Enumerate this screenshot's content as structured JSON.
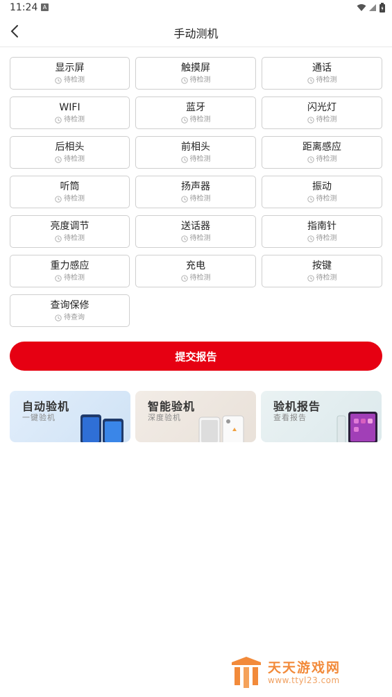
{
  "status_bar": {
    "time": "11:24",
    "notif_letter": "A"
  },
  "header": {
    "title": "手动测机"
  },
  "tests": [
    {
      "name": "显示屏",
      "status": "待检测"
    },
    {
      "name": "触摸屏",
      "status": "待检测"
    },
    {
      "name": "通话",
      "status": "待检测"
    },
    {
      "name": "WIFI",
      "status": "待检测"
    },
    {
      "name": "蓝牙",
      "status": "待检测"
    },
    {
      "name": "闪光灯",
      "status": "待检测"
    },
    {
      "name": "后相头",
      "status": "待检测"
    },
    {
      "name": "前相头",
      "status": "待检测"
    },
    {
      "name": "距离感应",
      "status": "待检测"
    },
    {
      "name": "听筒",
      "status": "待检测"
    },
    {
      "name": "扬声器",
      "status": "待检测"
    },
    {
      "name": "振动",
      "status": "待检测"
    },
    {
      "name": "亮度调节",
      "status": "待检测"
    },
    {
      "name": "送话器",
      "status": "待检测"
    },
    {
      "name": "指南针",
      "status": "待检测"
    },
    {
      "name": "重力感应",
      "status": "待检测"
    },
    {
      "name": "充电",
      "status": "待检测"
    },
    {
      "name": "按键",
      "status": "待检测"
    },
    {
      "name": "查询保修",
      "status": "待查询"
    }
  ],
  "submit_label": "提交报告",
  "banners": [
    {
      "title": "自动验机",
      "subtitle": "一键验机"
    },
    {
      "title": "智能验机",
      "subtitle": "深度验机"
    },
    {
      "title": "验机报告",
      "subtitle": "查看报告"
    }
  ],
  "watermark": {
    "name": "天天游戏网",
    "url": "www.ttyl23.com"
  },
  "colors": {
    "accent": "#e60012",
    "border": "#cfcfcf",
    "muted": "#999999"
  }
}
